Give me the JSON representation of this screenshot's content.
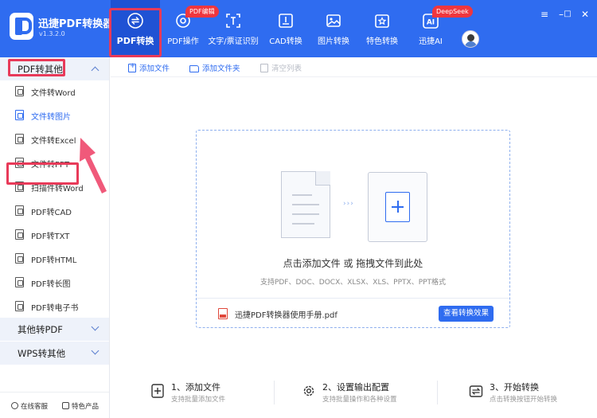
{
  "app": {
    "title": "迅捷PDF转换器",
    "version": "v1.3.2.0"
  },
  "nav": [
    {
      "label": "PDF转换",
      "icon": "convert-icon",
      "active": true
    },
    {
      "label": "PDF操作",
      "icon": "pdf-ops-icon",
      "badge": "PDF编辑"
    },
    {
      "label": "文字/票证识别",
      "icon": "ocr-icon"
    },
    {
      "label": "CAD转换",
      "icon": "cad-icon"
    },
    {
      "label": "图片转换",
      "icon": "image-icon"
    },
    {
      "label": "特色转换",
      "icon": "star-icon"
    },
    {
      "label": "迅捷AI",
      "icon": "ai-icon",
      "badge": "DeepSeek",
      "icon_text": "AI"
    }
  ],
  "window": {
    "menu": "≡",
    "minimize": "–",
    "maximize": "□",
    "close": "✕"
  },
  "sidebar": {
    "groups": [
      {
        "label": "PDF转其他",
        "expanded": true
      },
      {
        "label": "其他转PDF",
        "expanded": false
      },
      {
        "label": "WPS转其他",
        "expanded": false
      }
    ],
    "items": [
      {
        "label": "文件转Word"
      },
      {
        "label": "文件转图片",
        "active": true
      },
      {
        "label": "文件转Excel"
      },
      {
        "label": "文件转PPT"
      },
      {
        "label": "扫描件转Word"
      },
      {
        "label": "PDF转CAD"
      },
      {
        "label": "PDF转TXT"
      },
      {
        "label": "PDF转HTML"
      },
      {
        "label": "PDF转长图"
      },
      {
        "label": "PDF转电子书"
      }
    ],
    "footer": {
      "service": "在线客服",
      "features": "特色产品"
    }
  },
  "toolbar": {
    "add_file": "添加文件",
    "add_folder": "添加文件夹",
    "clear_list": "清空列表"
  },
  "dropzone": {
    "main_text": "点击添加文件 或 拖拽文件到此处",
    "sub_text": "支持PDF、DOC、DOCX、XLSX、XLS、PPTX、PPT格式",
    "dots": "›››",
    "file_name": "迅捷PDF转换器使用手册.pdf",
    "view_button": "查看转换效果"
  },
  "steps": [
    {
      "title": "1、添加文件",
      "desc": "支持批量添加文件"
    },
    {
      "title": "2、设置输出配置",
      "desc": "支持批量操作和各种设置"
    },
    {
      "title": "3、开始转换",
      "desc": "点击转换按钮开始转换"
    }
  ],
  "colors": {
    "primary": "#2f6cf0",
    "primary_dark": "#1f52d4",
    "highlight": "#e83a59",
    "badge": "#f0363e"
  }
}
